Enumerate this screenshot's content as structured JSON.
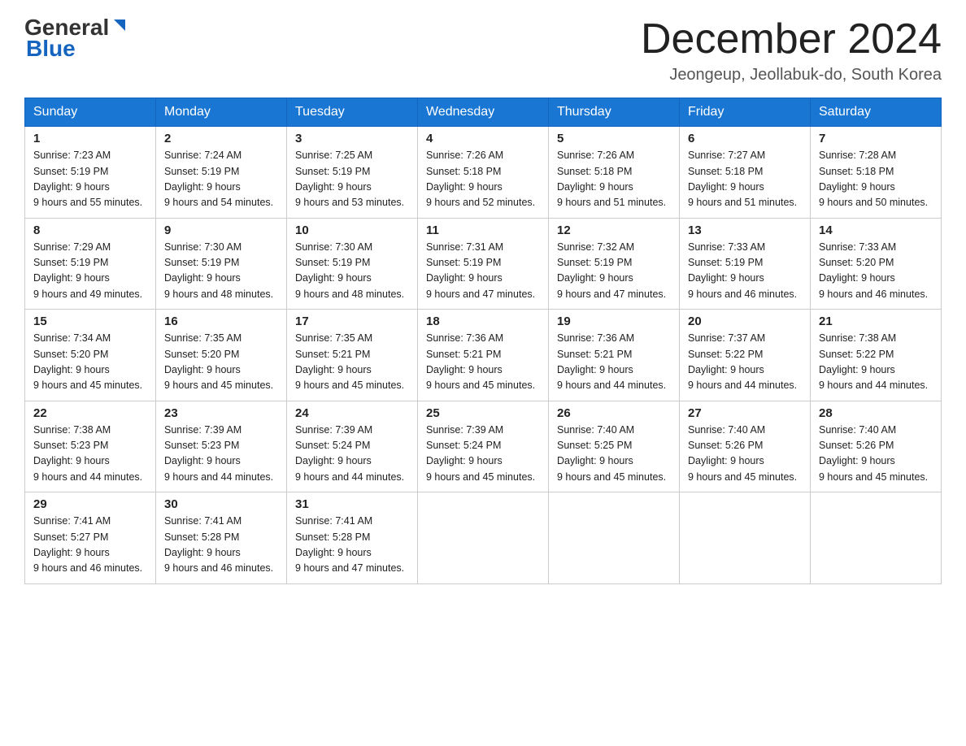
{
  "header": {
    "logo_general": "General",
    "logo_blue": "Blue",
    "month_title": "December 2024",
    "location": "Jeongeup, Jeollabuk-do, South Korea"
  },
  "days_of_week": [
    "Sunday",
    "Monday",
    "Tuesday",
    "Wednesday",
    "Thursday",
    "Friday",
    "Saturday"
  ],
  "weeks": [
    [
      {
        "day": "1",
        "sunrise": "7:23 AM",
        "sunset": "5:19 PM",
        "daylight": "9 hours and 55 minutes."
      },
      {
        "day": "2",
        "sunrise": "7:24 AM",
        "sunset": "5:19 PM",
        "daylight": "9 hours and 54 minutes."
      },
      {
        "day": "3",
        "sunrise": "7:25 AM",
        "sunset": "5:19 PM",
        "daylight": "9 hours and 53 minutes."
      },
      {
        "day": "4",
        "sunrise": "7:26 AM",
        "sunset": "5:18 PM",
        "daylight": "9 hours and 52 minutes."
      },
      {
        "day": "5",
        "sunrise": "7:26 AM",
        "sunset": "5:18 PM",
        "daylight": "9 hours and 51 minutes."
      },
      {
        "day": "6",
        "sunrise": "7:27 AM",
        "sunset": "5:18 PM",
        "daylight": "9 hours and 51 minutes."
      },
      {
        "day": "7",
        "sunrise": "7:28 AM",
        "sunset": "5:18 PM",
        "daylight": "9 hours and 50 minutes."
      }
    ],
    [
      {
        "day": "8",
        "sunrise": "7:29 AM",
        "sunset": "5:19 PM",
        "daylight": "9 hours and 49 minutes."
      },
      {
        "day": "9",
        "sunrise": "7:30 AM",
        "sunset": "5:19 PM",
        "daylight": "9 hours and 48 minutes."
      },
      {
        "day": "10",
        "sunrise": "7:30 AM",
        "sunset": "5:19 PM",
        "daylight": "9 hours and 48 minutes."
      },
      {
        "day": "11",
        "sunrise": "7:31 AM",
        "sunset": "5:19 PM",
        "daylight": "9 hours and 47 minutes."
      },
      {
        "day": "12",
        "sunrise": "7:32 AM",
        "sunset": "5:19 PM",
        "daylight": "9 hours and 47 minutes."
      },
      {
        "day": "13",
        "sunrise": "7:33 AM",
        "sunset": "5:19 PM",
        "daylight": "9 hours and 46 minutes."
      },
      {
        "day": "14",
        "sunrise": "7:33 AM",
        "sunset": "5:20 PM",
        "daylight": "9 hours and 46 minutes."
      }
    ],
    [
      {
        "day": "15",
        "sunrise": "7:34 AM",
        "sunset": "5:20 PM",
        "daylight": "9 hours and 45 minutes."
      },
      {
        "day": "16",
        "sunrise": "7:35 AM",
        "sunset": "5:20 PM",
        "daylight": "9 hours and 45 minutes."
      },
      {
        "day": "17",
        "sunrise": "7:35 AM",
        "sunset": "5:21 PM",
        "daylight": "9 hours and 45 minutes."
      },
      {
        "day": "18",
        "sunrise": "7:36 AM",
        "sunset": "5:21 PM",
        "daylight": "9 hours and 45 minutes."
      },
      {
        "day": "19",
        "sunrise": "7:36 AM",
        "sunset": "5:21 PM",
        "daylight": "9 hours and 44 minutes."
      },
      {
        "day": "20",
        "sunrise": "7:37 AM",
        "sunset": "5:22 PM",
        "daylight": "9 hours and 44 minutes."
      },
      {
        "day": "21",
        "sunrise": "7:38 AM",
        "sunset": "5:22 PM",
        "daylight": "9 hours and 44 minutes."
      }
    ],
    [
      {
        "day": "22",
        "sunrise": "7:38 AM",
        "sunset": "5:23 PM",
        "daylight": "9 hours and 44 minutes."
      },
      {
        "day": "23",
        "sunrise": "7:39 AM",
        "sunset": "5:23 PM",
        "daylight": "9 hours and 44 minutes."
      },
      {
        "day": "24",
        "sunrise": "7:39 AM",
        "sunset": "5:24 PM",
        "daylight": "9 hours and 44 minutes."
      },
      {
        "day": "25",
        "sunrise": "7:39 AM",
        "sunset": "5:24 PM",
        "daylight": "9 hours and 45 minutes."
      },
      {
        "day": "26",
        "sunrise": "7:40 AM",
        "sunset": "5:25 PM",
        "daylight": "9 hours and 45 minutes."
      },
      {
        "day": "27",
        "sunrise": "7:40 AM",
        "sunset": "5:26 PM",
        "daylight": "9 hours and 45 minutes."
      },
      {
        "day": "28",
        "sunrise": "7:40 AM",
        "sunset": "5:26 PM",
        "daylight": "9 hours and 45 minutes."
      }
    ],
    [
      {
        "day": "29",
        "sunrise": "7:41 AM",
        "sunset": "5:27 PM",
        "daylight": "9 hours and 46 minutes."
      },
      {
        "day": "30",
        "sunrise": "7:41 AM",
        "sunset": "5:28 PM",
        "daylight": "9 hours and 46 minutes."
      },
      {
        "day": "31",
        "sunrise": "7:41 AM",
        "sunset": "5:28 PM",
        "daylight": "9 hours and 47 minutes."
      },
      null,
      null,
      null,
      null
    ]
  ]
}
